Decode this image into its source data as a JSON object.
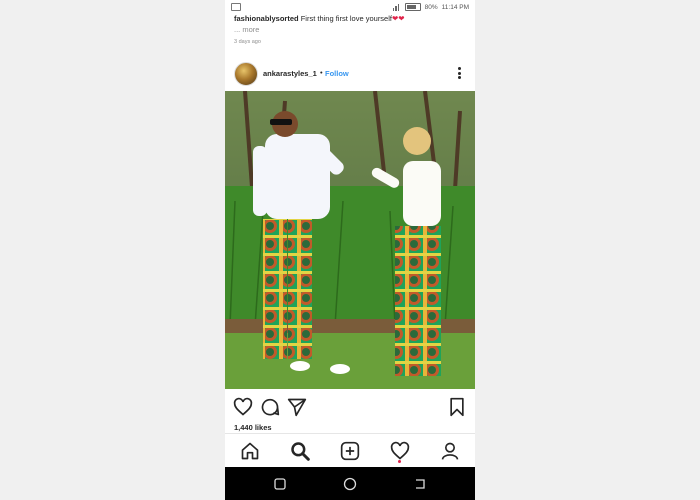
{
  "status_bar": {
    "battery": "80%",
    "time": "11:14 PM"
  },
  "prev_post": {
    "username": "fashionablysorted",
    "caption": "First thing first love yourself",
    "hearts": "❤❤",
    "more": "... more",
    "time_ago": "3 days ago"
  },
  "post": {
    "username": "ankarastyles_1",
    "dot": "•",
    "follow_label": "Follow",
    "likes": "1,440 likes"
  },
  "icons": {
    "actions": [
      "heart-icon",
      "comment-icon",
      "share-icon",
      "bookmark-icon"
    ],
    "tabs": [
      "home-icon",
      "search-icon",
      "add-post-icon",
      "activity-heart-icon",
      "profile-icon"
    ],
    "system_nav": [
      "recent-apps-icon",
      "home-circle-icon",
      "back-icon"
    ]
  },
  "colors": {
    "accent": "#3897f0",
    "heart": "#e0244a",
    "text": "#262626",
    "muted": "#8e8e8e"
  }
}
